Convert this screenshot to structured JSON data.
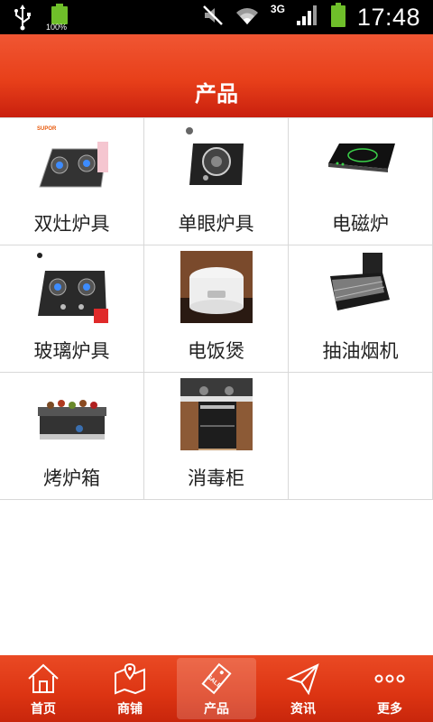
{
  "status_bar": {
    "time": "17:48",
    "battery_percent_label": "100%",
    "network_type": "3G",
    "icons": [
      "usb-icon",
      "battery-full-icon",
      "mute-icon",
      "wifi-icon",
      "signal-icon",
      "battery-icon"
    ]
  },
  "header": {
    "title": "产品"
  },
  "products": [
    {
      "label": "双灶炉具",
      "icon": "double-burner-stove"
    },
    {
      "label": "单眼炉具",
      "icon": "single-burner-stove"
    },
    {
      "label": "电磁炉",
      "icon": "induction-cooker"
    },
    {
      "label": "玻璃炉具",
      "icon": "glass-stove"
    },
    {
      "label": "电饭煲",
      "icon": "rice-cooker"
    },
    {
      "label": "抽油烟机",
      "icon": "range-hood"
    },
    {
      "label": "烤炉箱",
      "icon": "grill-oven"
    },
    {
      "label": "消毒柜",
      "icon": "sterilizer-cabinet"
    }
  ],
  "bottom_nav": [
    {
      "label": "首页",
      "icon": "home-icon",
      "active": false
    },
    {
      "label": "商铺",
      "icon": "map-icon",
      "active": false
    },
    {
      "label": "产品",
      "icon": "sale-tag-icon",
      "active": true
    },
    {
      "label": "资讯",
      "icon": "send-icon",
      "active": false
    },
    {
      "label": "更多",
      "icon": "more-icon",
      "active": false
    }
  ],
  "colors": {
    "header_red": "#e8401a",
    "nav_red": "#dc3412",
    "divider": "#d8d8d8"
  }
}
